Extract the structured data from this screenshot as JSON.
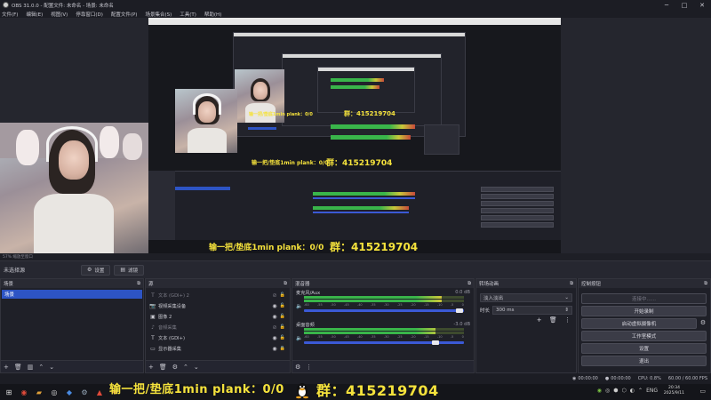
{
  "window": {
    "title": "OBS 31.0.0 - 配置文件: 未命名 - 场景: 未命名",
    "controls": [
      "─",
      "□",
      "✕"
    ]
  },
  "menu": [
    "文件(F)",
    "编辑(E)",
    "视图(V)",
    "停靠窗口(D)",
    "配置文件(P)",
    "场景集合(S)",
    "工具(T)",
    "帮助(H)"
  ],
  "preview": {
    "zoom_text": "57%  缩放至窗口",
    "overlay_banner": "输一把/垫底1min plank：0/0",
    "overlay_group": "群：415219704"
  },
  "source_bar": {
    "no_source": "未选择源",
    "properties_label": "设置",
    "filters_label": "滤镜"
  },
  "scenes": {
    "title": "场景",
    "items": [
      "场景"
    ]
  },
  "sources": {
    "title": "源",
    "items": [
      {
        "name": "文本 (GDI+) 2",
        "visible": false,
        "dim": true,
        "icon": "text-icon"
      },
      {
        "name": "视频采集设备",
        "visible": true,
        "dim": false,
        "icon": "camera-icon"
      },
      {
        "name": "图像 2",
        "visible": true,
        "dim": false,
        "icon": "image-icon"
      },
      {
        "name": "音频采集",
        "visible": false,
        "dim": true,
        "icon": "audio-icon"
      },
      {
        "name": "文本 (GDI+)",
        "visible": true,
        "dim": false,
        "icon": "text-icon"
      },
      {
        "name": "显示器采集",
        "visible": true,
        "dim": false,
        "icon": "monitor-icon"
      }
    ]
  },
  "mixer": {
    "title": "混音器",
    "channels": [
      {
        "name": "麦克风/Aux",
        "db": "0.0 dB",
        "level": 0.86,
        "volume": 0.97
      },
      {
        "name": "桌面音频",
        "db": "-3.0 dB",
        "level": 0.82,
        "volume": 0.82
      }
    ],
    "ticks": [
      "-60",
      "-55",
      "-50",
      "-45",
      "-40",
      "-35",
      "-30",
      "-25",
      "-20",
      "-15",
      "-10",
      "-5",
      "0"
    ]
  },
  "transitions": {
    "title": "转场动画",
    "selected": "淡入淡出",
    "duration_label": "时长",
    "duration_value": "300 ms"
  },
  "controls": {
    "title": "控制按钮",
    "streaming": "连接中......",
    "start_recording": "开始录制",
    "virtual_camera": "启动虚拟摄像机",
    "studio_mode": "工作室模式",
    "settings": "设置",
    "exit": "退出"
  },
  "status": {
    "stream_time": "00:00:00",
    "rec_time": "00:00:00",
    "cpu": "CPU: 0.8%",
    "fps": "60.00 / 60.00 FPS"
  },
  "taskbar": {
    "banner": "输一把/垫底1min plank：0/0",
    "group": "群：415219704",
    "lang": "ENG",
    "time": "20:34",
    "date": "2025/9/11"
  },
  "colors": {
    "accent": "#2d54c4",
    "banner_yellow": "#f5e23c",
    "meter_green": "#39b54a"
  }
}
